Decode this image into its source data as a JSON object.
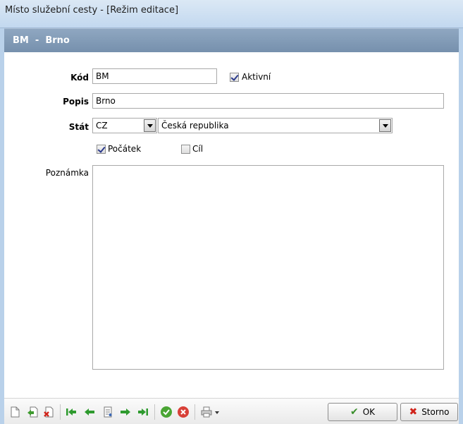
{
  "window": {
    "title": "Místo služební cesty - [Režim editace]"
  },
  "header": {
    "text": "BM  -  Brno"
  },
  "form": {
    "kod": {
      "label": "Kód",
      "value": "BM"
    },
    "aktivni": {
      "label": "Aktivní",
      "checked": true
    },
    "popis": {
      "label": "Popis",
      "value": "Brno"
    },
    "stat": {
      "label": "Stát",
      "code": "CZ",
      "name": "Česká republika"
    },
    "pocatek": {
      "label": "Počátek",
      "checked": true
    },
    "cil": {
      "label": "Cíl",
      "checked": false
    },
    "poznamka": {
      "label": "Poznámka",
      "value": ""
    }
  },
  "toolbar": {
    "icons": [
      "new-record-icon",
      "copy-record-icon",
      "delete-record-icon",
      "first-record-icon",
      "previous-record-icon",
      "record-detail-icon",
      "next-record-icon",
      "last-record-icon",
      "confirm-icon",
      "cancel-icon",
      "print-icon"
    ],
    "ok_label": "OK",
    "storno_label": "Storno"
  },
  "colors": {
    "header_band": "#7f98b5",
    "window_frame": "#b9d1ea",
    "ok_check": "#3a8f2c",
    "storno_x": "#d0241b",
    "confirm_green": "#4aa534",
    "cancel_red": "#d84038"
  }
}
